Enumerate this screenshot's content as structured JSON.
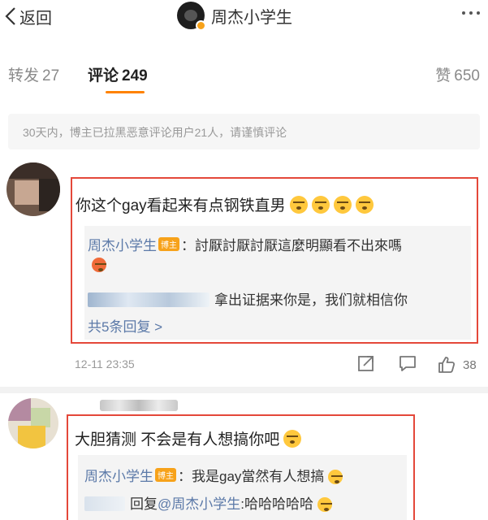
{
  "nav": {
    "back_label": "返回",
    "title": "周杰小学生"
  },
  "tabs": {
    "repost_label": "转发",
    "repost_count": "27",
    "comment_label": "评论",
    "comment_count": "249",
    "like_label": "赞",
    "like_count": "650",
    "accent_color": "#ff8200"
  },
  "notice": "30天内，博主已拉黑恶意评论用户21人，请谨慎评论",
  "comments": [
    {
      "text": "你这个gay看起来有点钢铁直男",
      "replies": {
        "first_name": "周杰小学生",
        "first_tag": "博主",
        "first_text": "：討厭討厭討厭這麼明顯看不出來嗎",
        "second_text": "拿出证据来你是，我们就相信你",
        "more_link": "共5条回复 >"
      },
      "time": "12-11 23:35",
      "like_count": "38"
    },
    {
      "text": "大胆猜测  不会是有人想搞你吧",
      "replies": {
        "first_name": "周杰小学生",
        "first_tag": "博主",
        "first_text": "：我是gay當然有人想搞",
        "second_prefix": "回复",
        "second_mention": "@周杰小学生",
        "second_text": ":哈哈哈哈哈"
      }
    }
  ],
  "colors": {
    "highlight_box": "#e4483a",
    "link": "#5b79a8",
    "badge": "#f7a21a"
  }
}
